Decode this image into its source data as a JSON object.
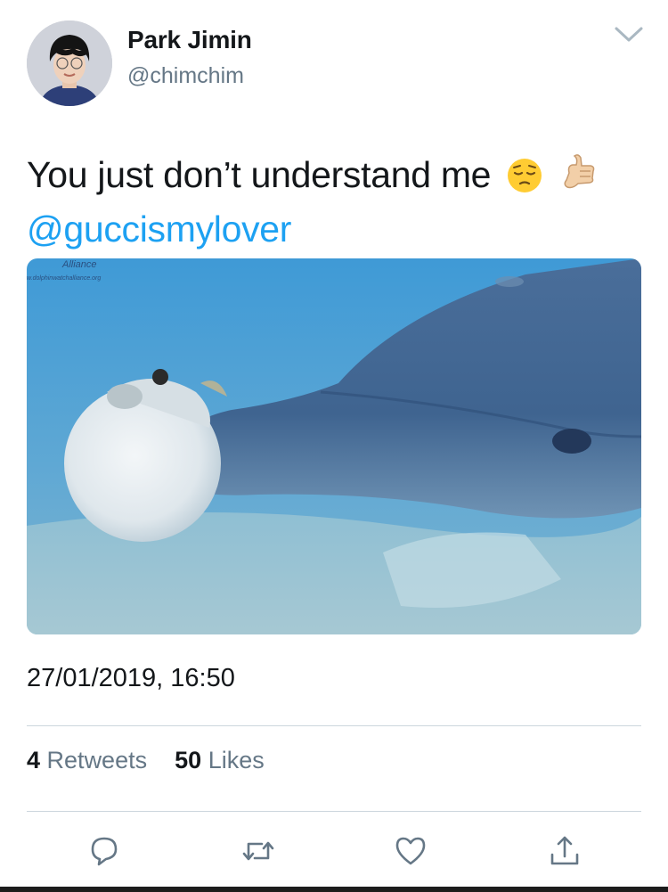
{
  "user": {
    "name": "Park Jimin",
    "handle": "@chimchim"
  },
  "tweet": {
    "text": "You just don’t understand me",
    "emojis": [
      "pensive-face",
      "call-me-hand"
    ],
    "mention": "@guccismylover",
    "timestamp": "27/01/2019, 16:50"
  },
  "media": {
    "watermark_line1": "Alliance",
    "watermark_line2": "w.dolphinwatchalliance.org"
  },
  "stats": {
    "retweets_count": "4",
    "retweets_label": "Retweets",
    "likes_count": "50",
    "likes_label": "Likes"
  },
  "actions": [
    "reply-icon",
    "retweet-icon",
    "like-icon",
    "share-icon"
  ],
  "colors": {
    "link": "#1da1f2",
    "secondary": "#657786",
    "text": "#14171a"
  }
}
